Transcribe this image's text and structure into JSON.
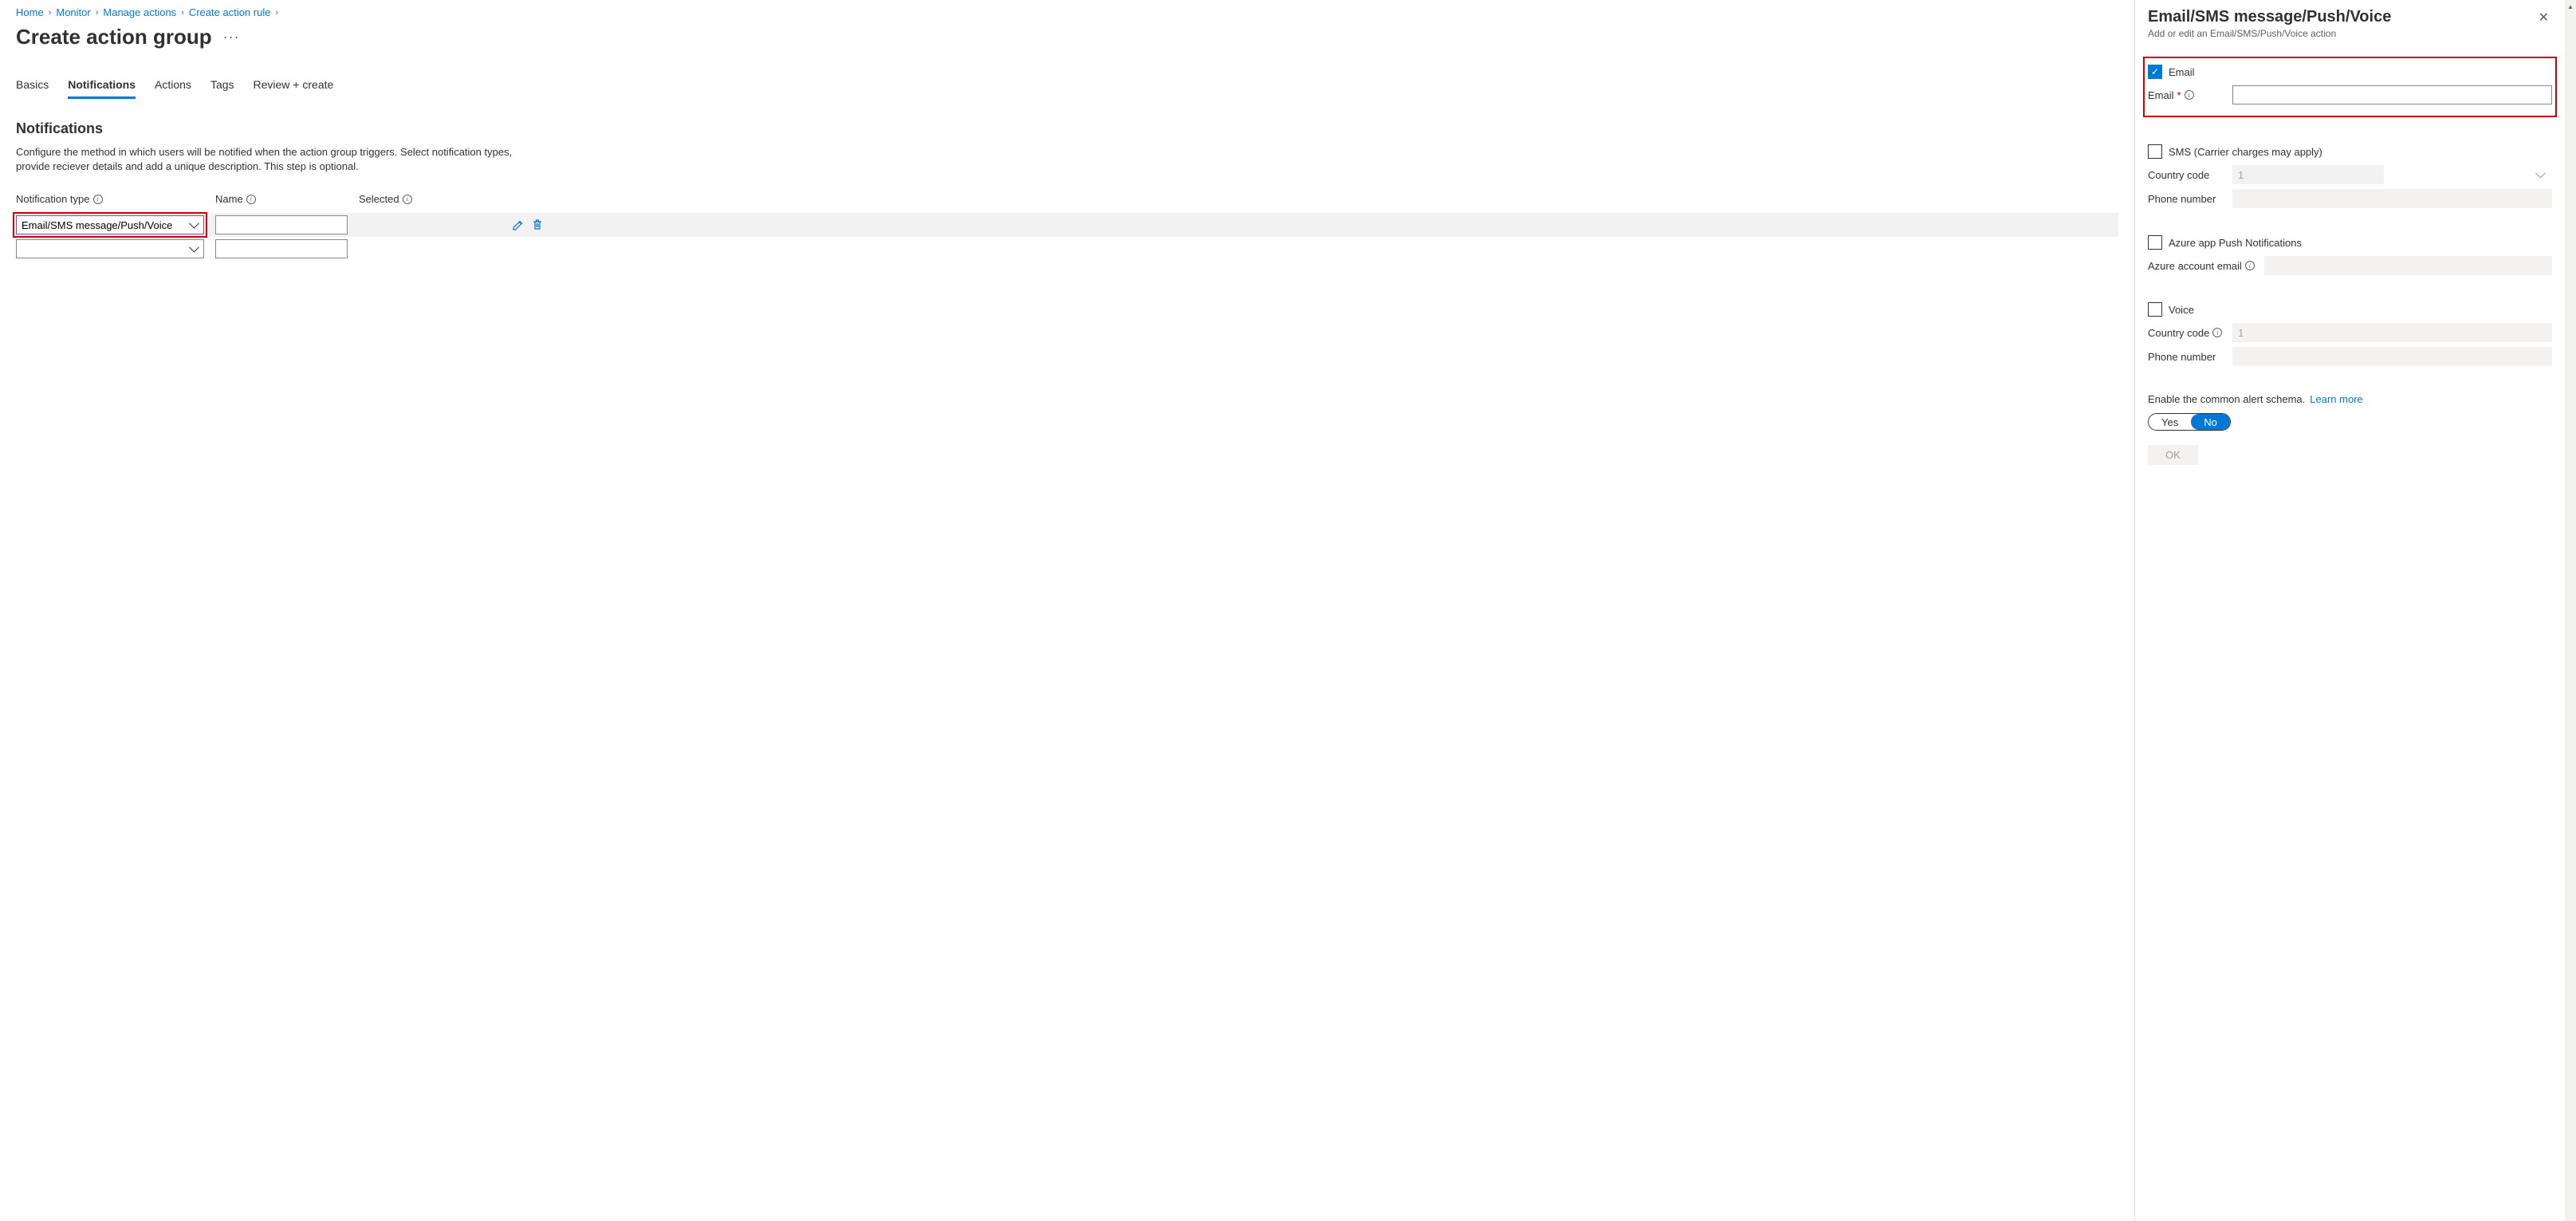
{
  "breadcrumb": [
    {
      "label": "Home"
    },
    {
      "label": "Monitor"
    },
    {
      "label": "Manage actions"
    },
    {
      "label": "Create action rule"
    }
  ],
  "page_title": "Create action group",
  "tabs": [
    {
      "label": "Basics",
      "active": false
    },
    {
      "label": "Notifications",
      "active": true
    },
    {
      "label": "Actions",
      "active": false
    },
    {
      "label": "Tags",
      "active": false
    },
    {
      "label": "Review + create",
      "active": false
    }
  ],
  "section": {
    "title": "Notifications",
    "description": "Configure the method in which users will be notified when the action group triggers. Select notification types, provide reciever details and add a unique description. This step is optional."
  },
  "columns": {
    "notification_type": "Notification type",
    "name": "Name",
    "selected": "Selected"
  },
  "rows": [
    {
      "type": "Email/SMS message/Push/Voice",
      "name": "",
      "highlighted": true,
      "actions": true
    },
    {
      "type": "",
      "name": "",
      "highlighted": false,
      "actions": false
    }
  ],
  "pane": {
    "title": "Email/SMS message/Push/Voice",
    "subtitle": "Add or edit an Email/SMS/Push/Voice action",
    "email": {
      "check_label": "Email",
      "field_label": "Email",
      "value": ""
    },
    "sms": {
      "check_label": "SMS (Carrier charges may apply)",
      "country_label": "Country code",
      "country_value": "1",
      "phone_label": "Phone number",
      "phone_value": ""
    },
    "push": {
      "check_label": "Azure app Push Notifications",
      "account_label": "Azure account email",
      "account_value": ""
    },
    "voice": {
      "check_label": "Voice",
      "country_label": "Country code",
      "country_value": "1",
      "phone_label": "Phone number",
      "phone_value": ""
    },
    "schema": {
      "text": "Enable the common alert schema.",
      "link": "Learn more",
      "yes": "Yes",
      "no": "No"
    },
    "ok": "OK"
  }
}
